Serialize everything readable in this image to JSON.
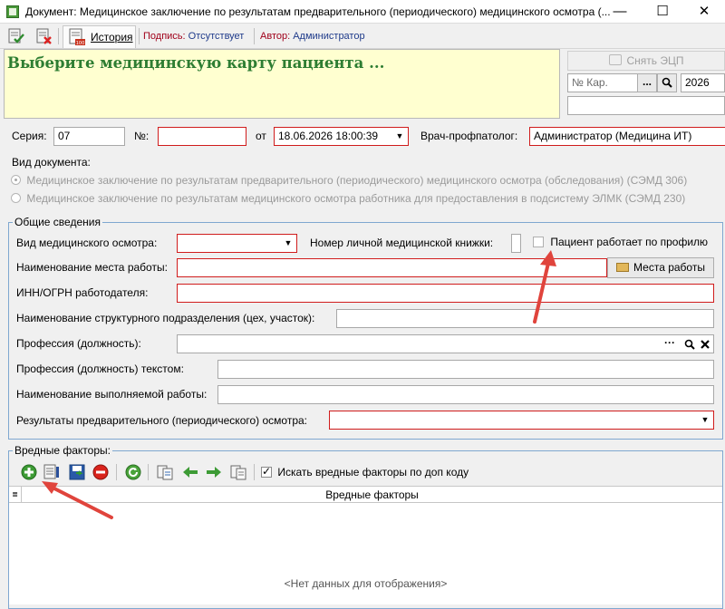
{
  "window": {
    "title": "Документ: Медицинское заключение по результатам предварительного (периодического) медицинского осмотра (...",
    "minimize": "—",
    "maximize": "☐",
    "close": "✕"
  },
  "toolbar": {
    "history_tab": "История",
    "signature_label": "Подпись:",
    "signature_value": "Отсутствует",
    "author_label": "Автор:",
    "author_value": "Администратор"
  },
  "banner": {
    "message": "Выберите медицинскую карту пациента ..."
  },
  "right_panel": {
    "remove_ecp": "Снять ЭЦП",
    "card_placeholder": "№ Кар.",
    "ellipsis": "...",
    "year": "2026"
  },
  "header_fields": {
    "series_label": "Серия:",
    "series_value": "07",
    "number_label": "№:",
    "number_value": "",
    "date_label": "от",
    "date_value": "18.06.2026 18:00:39",
    "doctor_label": "Врач-профпатолог:",
    "doctor_value": "Администратор (Медицина ИТ)"
  },
  "doc_type": {
    "label": "Вид документа:",
    "option1": "Медицинское заключение по результатам предварительного (периодического) медицинского осмотра (обследования) (СЭМД 306)",
    "option2": "Медицинское заключение по результатам медицинского осмотра работника для предоставления в подсистему ЭЛМК (СЭМД 230)"
  },
  "general": {
    "title": "Общие сведения",
    "exam_type_label": "Вид медицинского осмотра:",
    "medbook_label": "Номер личной медицинской книжки:",
    "works_by_profile_label": "Пациент работает по профилю",
    "workplace_label": "Наименование места работы:",
    "workplaces_button": "Места работы",
    "inn_label": "ИНН/ОГРН работодателя:",
    "division_label": "Наименование структурного подразделения (цех, участок):",
    "profession_label": "Профессия (должность):",
    "profession_text_label": "Профессия (должность) текстом:",
    "work_label": "Наименование выполняемой работы:",
    "results_label": "Результаты предварительного (периодического) осмотра:"
  },
  "hazards": {
    "title": "Вредные факторы:",
    "search_by_code_label": "Искать вредные факторы по доп коду",
    "column_header": "Вредные факторы",
    "empty_text": "<Нет данных для отображения>"
  },
  "colors": {
    "required_border": "#d01c1c",
    "banner_bg": "#ffffd0",
    "banner_text": "#2e7d32",
    "group_border": "#7fa7d0",
    "annotation_arrow": "#e0443c"
  }
}
